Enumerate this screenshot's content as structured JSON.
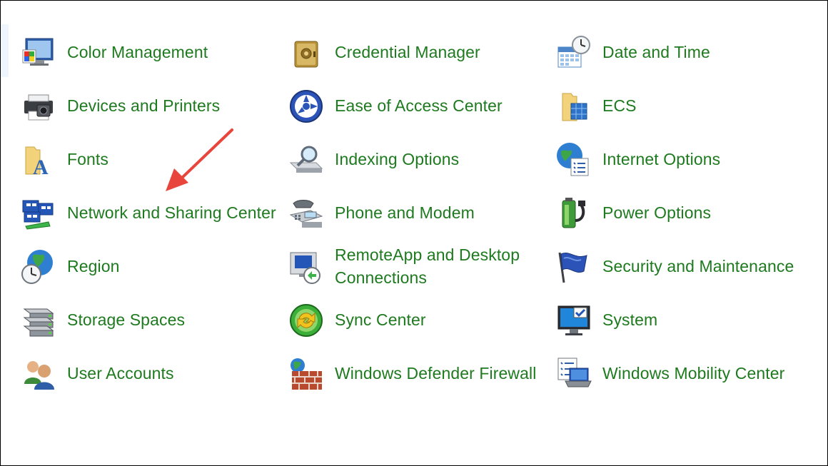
{
  "items": [
    {
      "label": "Color Management",
      "icon": "color-management-icon"
    },
    {
      "label": "Credential Manager",
      "icon": "credential-manager-icon"
    },
    {
      "label": "Date and Time",
      "icon": "date-time-icon"
    },
    {
      "label": "Devices and Printers",
      "icon": "printer-icon"
    },
    {
      "label": "Ease of Access Center",
      "icon": "ease-of-access-icon"
    },
    {
      "label": "ECS",
      "icon": "ecs-folder-icon"
    },
    {
      "label": "Fonts",
      "icon": "fonts-folder-icon"
    },
    {
      "label": "Indexing Options",
      "icon": "indexing-icon"
    },
    {
      "label": "Internet Options",
      "icon": "internet-options-icon"
    },
    {
      "label": "Network and Sharing Center",
      "icon": "network-icon"
    },
    {
      "label": "Phone and Modem",
      "icon": "phone-icon"
    },
    {
      "label": "Power Options",
      "icon": "power-icon"
    },
    {
      "label": "Region",
      "icon": "region-globe-clock-icon"
    },
    {
      "label": "RemoteApp and Desktop Connections",
      "icon": "remoteapp-icon"
    },
    {
      "label": "Security and Maintenance",
      "icon": "security-flag-icon"
    },
    {
      "label": "Storage Spaces",
      "icon": "storage-icon"
    },
    {
      "label": "Sync Center",
      "icon": "sync-icon"
    },
    {
      "label": "System",
      "icon": "system-monitor-icon"
    },
    {
      "label": "User Accounts",
      "icon": "user-accounts-icon"
    },
    {
      "label": "Windows Defender Firewall",
      "icon": "firewall-icon"
    },
    {
      "label": "Windows Mobility Center",
      "icon": "mobility-center-icon"
    }
  ],
  "colors": {
    "link_text": "#1e7a1e",
    "annotation_arrow": "#e8453c",
    "background": "#ffffff"
  }
}
